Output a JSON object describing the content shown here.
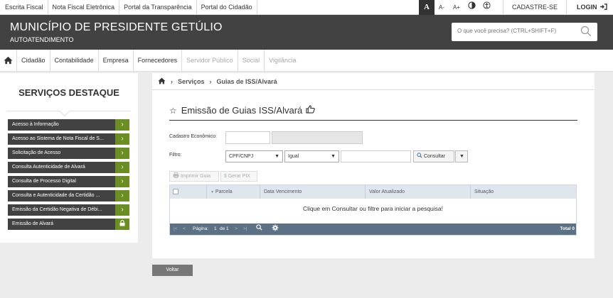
{
  "toplinks": [
    "Escrita Fiscal",
    "Nota Fiscal Eletrônica",
    "Portal da Transparência",
    "Portal do Cidadão"
  ],
  "topright": {
    "font_a": "A",
    "font_minus": "A-",
    "font_plus": "A+",
    "cadastre": "CADASTRE-SE",
    "login": "LOGIN"
  },
  "header": {
    "title": "MUNICÍPIO DE PRESIDENTE GETÚLIO",
    "subtitle": "AUTOATENDIMENTO",
    "search_placeholder": "O que você precisa? (CTRL+SHIFT+F)"
  },
  "nav": {
    "items": [
      {
        "label": "Cidadão"
      },
      {
        "label": "Contabilidade"
      },
      {
        "label": "Empresa"
      },
      {
        "label": "Fornecedores"
      },
      {
        "label": "Servidor Público"
      },
      {
        "label": "Social"
      },
      {
        "label": "Vigilância"
      }
    ]
  },
  "sidebar": {
    "title": "SERVIÇOS DESTAQUE",
    "items": [
      {
        "label": "Acesso à Informação"
      },
      {
        "label": "Acesso ao Sistema de Nota Fiscal de S..."
      },
      {
        "label": "Solicitação de Acesso"
      },
      {
        "label": "Consulta Autenticidade de Alvará"
      },
      {
        "label": "Consulta de Processo Digital"
      },
      {
        "label": "Consulta e Autenticidade da Certidão ..."
      },
      {
        "label": "Emissão da Certidão Negativa de Débi..."
      },
      {
        "label": "Emissão de Alvará"
      }
    ]
  },
  "breadcrumb": {
    "level1": "Serviços",
    "level2": "Guias de ISS/Alvará"
  },
  "page": {
    "title": "Emissão de Guias ISS/Alvará"
  },
  "form": {
    "cadastro_label": "Cadastro Econômico:",
    "filtro_label": "Filtro:",
    "filter_field": "CPF/CNPJ",
    "filter_op": "Igual",
    "consultar": "Consultar",
    "imprimir": "Imprimir Guia",
    "gerar_pix": "Gerar PIX"
  },
  "grid": {
    "columns": [
      "Parcela",
      "Data Vencimento",
      "Valor Atualizado",
      "Situação"
    ],
    "empty_message": "Clique em Consultar ou filtre para iniciar a pesquisa!",
    "pager_label": "Página:",
    "pager_page": "1",
    "pager_of": "de 1",
    "total": "Total 0"
  },
  "voltar": "Voltar"
}
